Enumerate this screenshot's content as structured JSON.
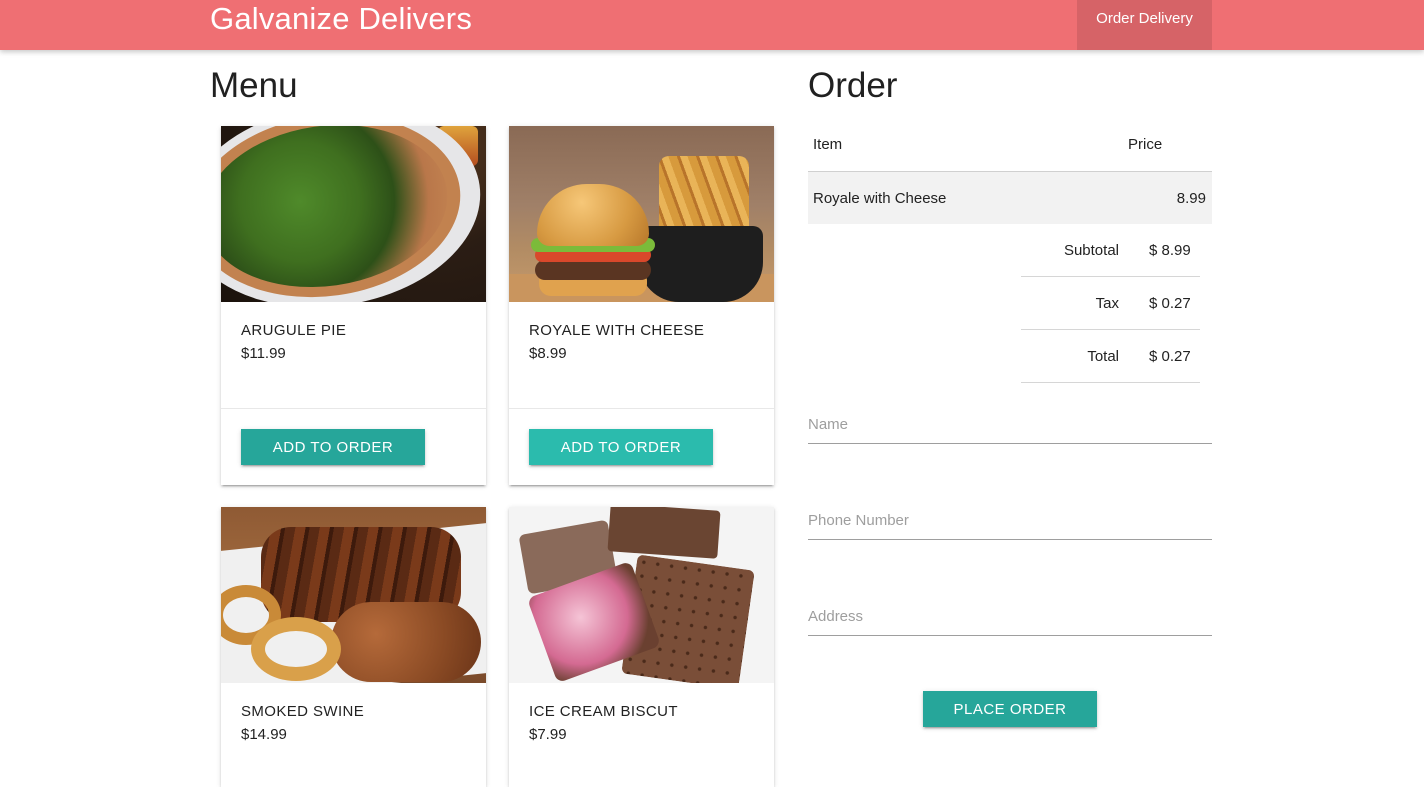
{
  "header": {
    "brand": "Galvanize Delivers",
    "nav_link": "Order Delivery",
    "color": "#ef6f73"
  },
  "menu": {
    "title": "Menu",
    "add_label": "ADD TO ORDER",
    "items": [
      {
        "name": "ARUGULE PIE",
        "price": "$11.99",
        "image": "pizza-photo"
      },
      {
        "name": "ROYALE WITH CHEESE",
        "price": "$8.99",
        "image": "burger-photo"
      },
      {
        "name": "SMOKED SWINE",
        "price": "$14.99",
        "image": "ribs-photo"
      },
      {
        "name": "ICE CREAM BISCUT",
        "price": "$7.99",
        "image": "ice-cream-sandwich-photo"
      }
    ]
  },
  "order": {
    "title": "Order",
    "columns": {
      "item": "Item",
      "price": "Price"
    },
    "rows": [
      {
        "item": "Royale with Cheese",
        "price": "8.99"
      }
    ],
    "totals": {
      "subtotal_label": "Subtotal",
      "subtotal": "$ 8.99",
      "tax_label": "Tax",
      "tax": "$ 0.27",
      "total_label": "Total",
      "total": "$ 0.27"
    },
    "form": {
      "name_placeholder": "Name",
      "phone_placeholder": "Phone Number",
      "address_placeholder": "Address",
      "submit_label": "PLACE ORDER"
    }
  },
  "colors": {
    "button": "#26a69a",
    "button_hover": "#2bbbad"
  }
}
